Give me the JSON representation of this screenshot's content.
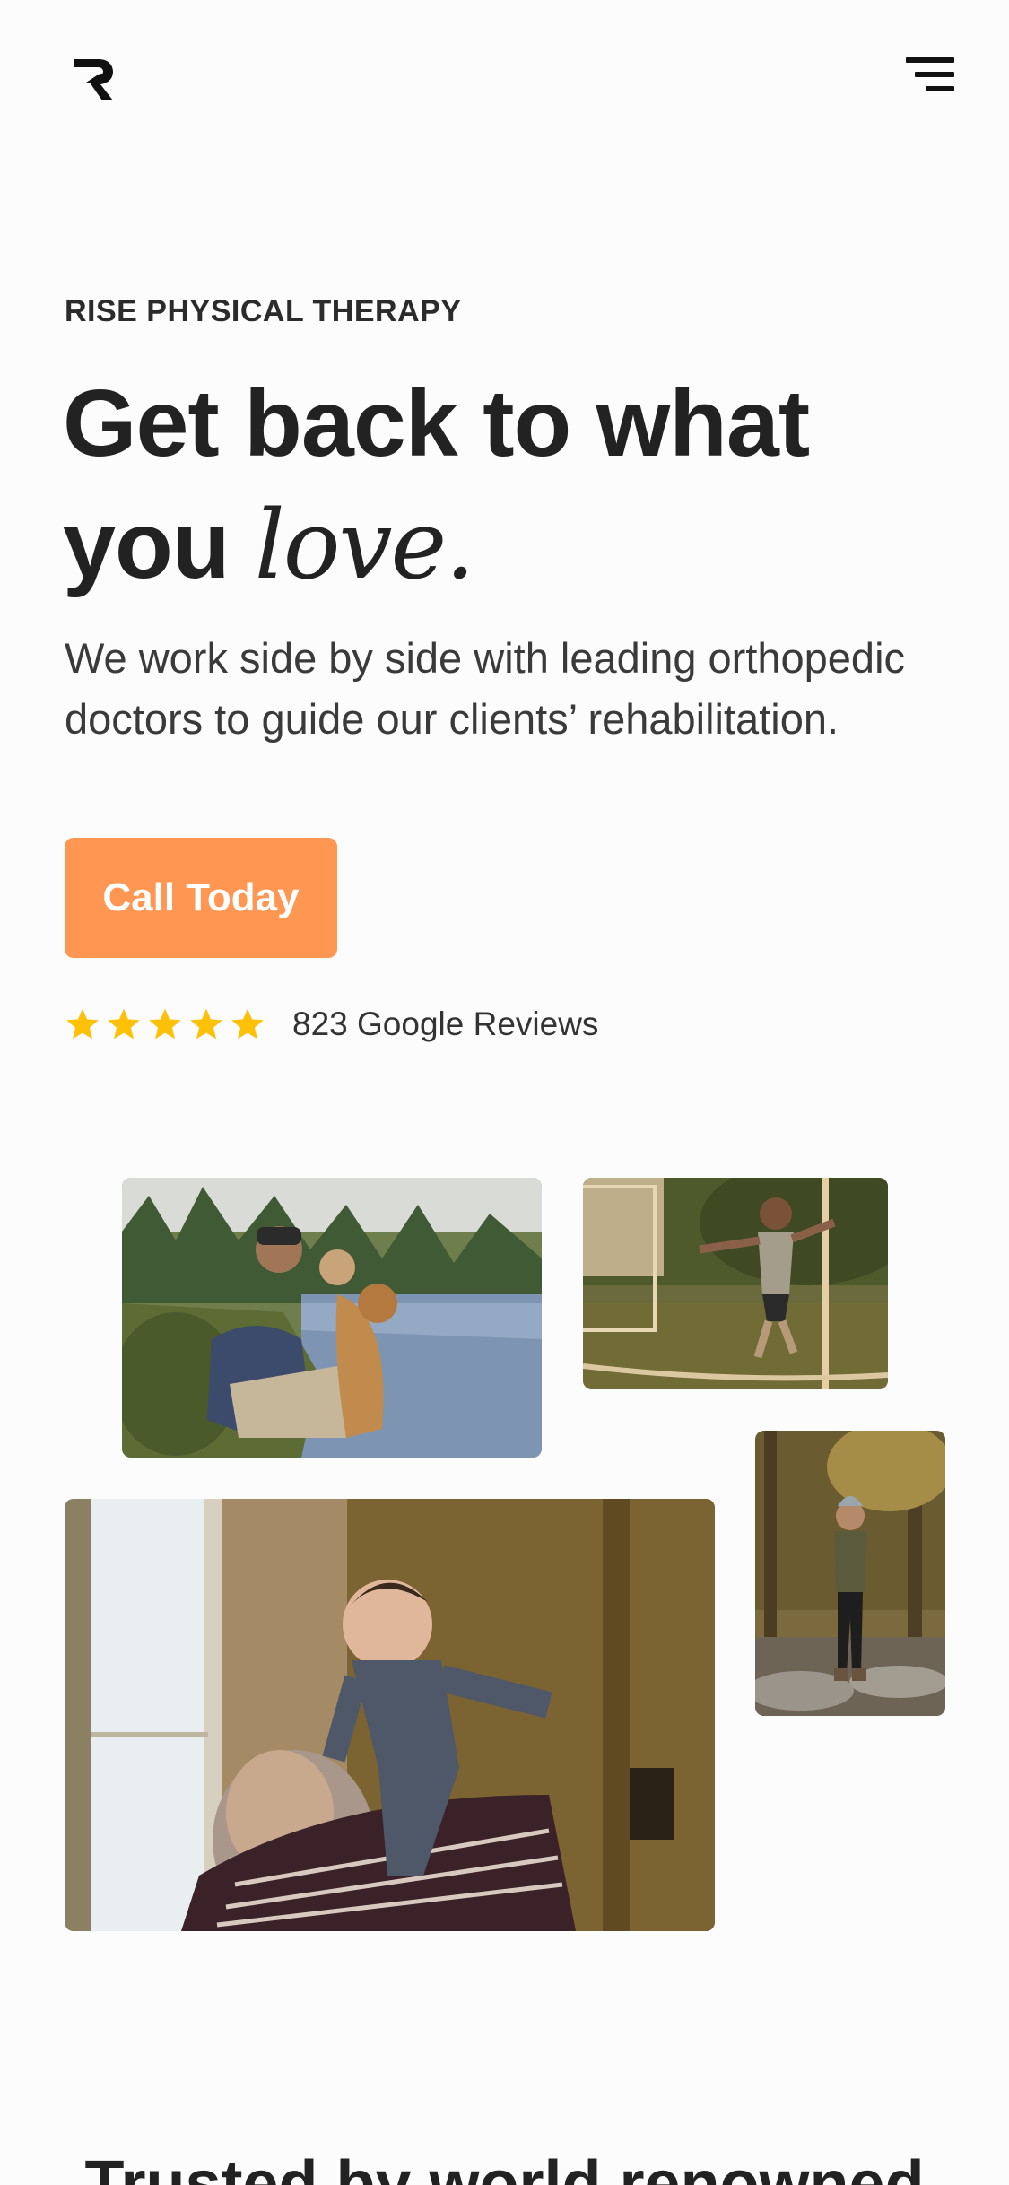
{
  "header": {
    "logo_icon": "r-logo-icon",
    "menu_icon": "hamburger-menu-icon"
  },
  "hero": {
    "eyebrow": "RISE PHYSICAL THERAPY",
    "headline_line1": "Get back to what",
    "headline_line2_plain": "you ",
    "headline_line2_script": "love.",
    "subtext": "We work side by side with leading orthopedic doctors to guide our clients’ rehabilitation.",
    "cta_label": "Call Today",
    "rating_stars": 5,
    "reviews_label": "823 Google Reviews"
  },
  "photos": {
    "icons": [
      "couple-with-dog-photo",
      "kid-playing-soccer-photo",
      "hiker-woman-photo",
      "grandfather-lifting-baby-photo"
    ]
  },
  "next_section": {
    "heading": "Trusted by world renowned"
  },
  "colors": {
    "accent": "#ff9651",
    "star": "#ffc107",
    "text": "#222222",
    "background": "#fcfcfc"
  }
}
